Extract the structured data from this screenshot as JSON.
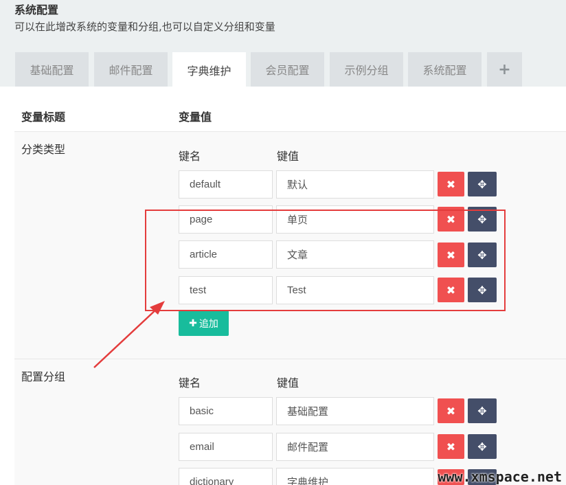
{
  "header": {
    "title": "系统配置",
    "description": "可以在此增改系统的变量和分组,也可以自定义分组和变量"
  },
  "tabs": [
    {
      "label": "基础配置"
    },
    {
      "label": "邮件配置"
    },
    {
      "label": "字典维护"
    },
    {
      "label": "会员配置"
    },
    {
      "label": "示例分组"
    },
    {
      "label": "系统配置"
    },
    {
      "label": "+"
    }
  ],
  "table": {
    "col_title": "变量标题",
    "col_value": "变量值"
  },
  "groups": [
    {
      "label": "分类类型",
      "key_header": "键名",
      "value_header": "键值",
      "rows": [
        {
          "key": "default",
          "value": "默认"
        },
        {
          "key": "page",
          "value": "单页"
        },
        {
          "key": "article",
          "value": "文章"
        },
        {
          "key": "test",
          "value": "Test"
        }
      ],
      "add_label": "追加"
    },
    {
      "label": "配置分组",
      "key_header": "键名",
      "value_header": "键值",
      "rows": [
        {
          "key": "basic",
          "value": "基础配置"
        },
        {
          "key": "email",
          "value": "邮件配置"
        },
        {
          "key": "dictionary",
          "value": "字典维护"
        }
      ]
    }
  ],
  "watermark": "www.xmspace.net",
  "colors": {
    "delete": "#f05050",
    "move": "#444e69",
    "add": "#18bc9c",
    "annotation": "#e43c3c"
  }
}
